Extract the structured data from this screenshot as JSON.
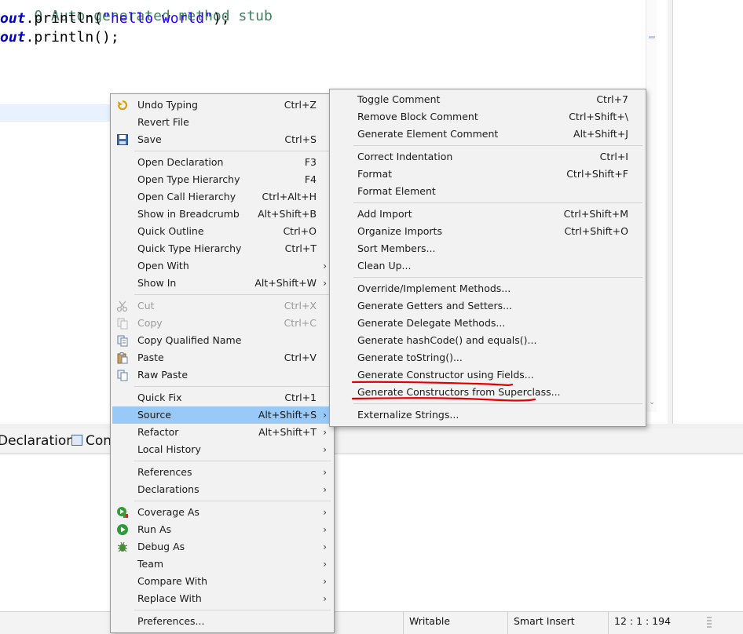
{
  "editor": {
    "lines": [
      {
        "type": "comment",
        "text": "0 Auto-generated method stub"
      },
      {
        "type": "code",
        "kw": "out",
        "rest": ".println(",
        "str": "\"hello world\"",
        "end": ");"
      },
      {
        "type": "code",
        "kw": "out",
        "rest": ".println();",
        "str": "",
        "end": ""
      }
    ]
  },
  "context_menu": {
    "items": [
      {
        "label": "Undo Typing",
        "acc": "Ctrl+Z",
        "icon": "undo-icon"
      },
      {
        "label": "Revert File",
        "acc": ""
      },
      {
        "label": "Save",
        "acc": "Ctrl+S",
        "icon": "save-icon"
      },
      {
        "label": "Open Declaration",
        "acc": "F3"
      },
      {
        "label": "Open Type Hierarchy",
        "acc": "F4"
      },
      {
        "label": "Open Call Hierarchy",
        "acc": "Ctrl+Alt+H"
      },
      {
        "label": "Show in Breadcrumb",
        "acc": "Alt+Shift+B"
      },
      {
        "label": "Quick Outline",
        "acc": "Ctrl+O"
      },
      {
        "label": "Quick Type Hierarchy",
        "acc": "Ctrl+T"
      },
      {
        "label": "Open With",
        "acc": "",
        "submenu": true
      },
      {
        "label": "Show In",
        "acc": "Alt+Shift+W",
        "submenu": true
      },
      {
        "label": "Cut",
        "acc": "Ctrl+X",
        "disabled": true,
        "icon": "cut-icon"
      },
      {
        "label": "Copy",
        "acc": "Ctrl+C",
        "disabled": true,
        "icon": "copy-icon"
      },
      {
        "label": "Copy Qualified Name",
        "acc": "",
        "icon": "copy-qualified-icon"
      },
      {
        "label": "Paste",
        "acc": "Ctrl+V",
        "icon": "paste-icon"
      },
      {
        "label": "Raw Paste",
        "acc": "",
        "icon": "raw-paste-icon"
      },
      {
        "label": "Quick Fix",
        "acc": "Ctrl+1"
      },
      {
        "label": "Source",
        "acc": "Alt+Shift+S",
        "submenu": true,
        "selected": true
      },
      {
        "label": "Refactor",
        "acc": "Alt+Shift+T",
        "submenu": true
      },
      {
        "label": "Local History",
        "acc": "",
        "submenu": true
      },
      {
        "label": "References",
        "acc": "",
        "submenu": true
      },
      {
        "label": "Declarations",
        "acc": "",
        "submenu": true
      },
      {
        "label": "Coverage As",
        "acc": "",
        "submenu": true,
        "icon": "coverage-icon"
      },
      {
        "label": "Run As",
        "acc": "",
        "submenu": true,
        "icon": "run-icon"
      },
      {
        "label": "Debug As",
        "acc": "",
        "submenu": true,
        "icon": "debug-icon"
      },
      {
        "label": "Team",
        "acc": "",
        "submenu": true
      },
      {
        "label": "Compare With",
        "acc": "",
        "submenu": true
      },
      {
        "label": "Replace With",
        "acc": "",
        "submenu": true
      },
      {
        "label": "Preferences...",
        "acc": ""
      }
    ]
  },
  "source_submenu": {
    "items": [
      {
        "label": "Toggle Comment",
        "acc": "Ctrl+7"
      },
      {
        "label": "Remove Block Comment",
        "acc": "Ctrl+Shift+\\"
      },
      {
        "label": "Generate Element Comment",
        "acc": "Alt+Shift+J"
      },
      {
        "label": "Correct Indentation",
        "acc": "Ctrl+I"
      },
      {
        "label": "Format",
        "acc": "Ctrl+Shift+F"
      },
      {
        "label": "Format Element",
        "acc": ""
      },
      {
        "label": "Add Import",
        "acc": "Ctrl+Shift+M"
      },
      {
        "label": "Organize Imports",
        "acc": "Ctrl+Shift+O"
      },
      {
        "label": "Sort Members...",
        "acc": ""
      },
      {
        "label": "Clean Up...",
        "acc": ""
      },
      {
        "label": "Override/Implement Methods...",
        "acc": ""
      },
      {
        "label": "Generate Getters and Setters...",
        "acc": ""
      },
      {
        "label": "Generate Delegate Methods...",
        "acc": ""
      },
      {
        "label": "Generate hashCode() and equals()...",
        "acc": ""
      },
      {
        "label": "Generate toString()...",
        "acc": ""
      },
      {
        "label": "Generate Constructor using Fields...",
        "acc": "",
        "underlined": true
      },
      {
        "label": "Generate Constructors from Superclass...",
        "acc": "",
        "underlined": true
      },
      {
        "label": "Externalize Strings...",
        "acc": ""
      }
    ]
  },
  "bottom_panel": {
    "tabs": [
      {
        "label": "Declaration"
      },
      {
        "label": "Cons"
      }
    ]
  },
  "statusbar": {
    "writable": "Writable",
    "insert_mode": "Smart Insert",
    "position": "12 : 1 : 194"
  },
  "colors": {
    "selection": "#99c9f7",
    "annotation_red": "#e00000",
    "menu_bg": "#f2f2f2",
    "current_line": "#e8f2fe"
  }
}
